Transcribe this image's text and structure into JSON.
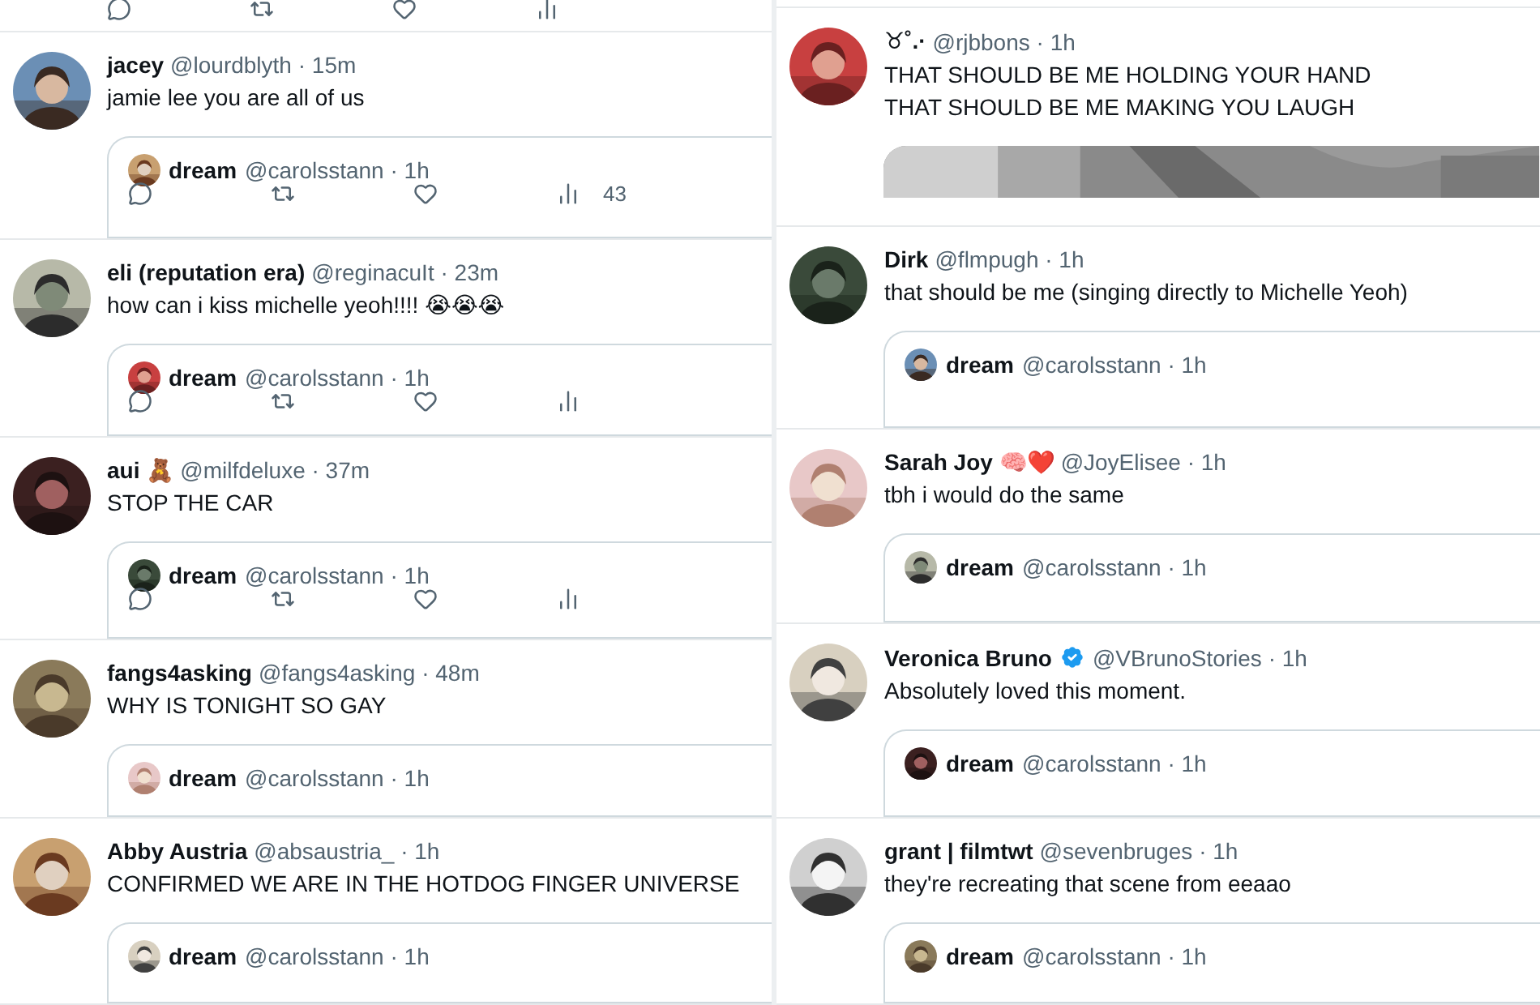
{
  "columns": [
    {
      "top_actions": true,
      "tweets": [
        {
          "name": "jacey",
          "meta": "@lourdblyth · 15m",
          "text": "jamie lee you are all of us",
          "verified": false,
          "quote": {
            "name": "dream",
            "meta": "@carolsstann · 1h"
          },
          "actions": true,
          "views": "43"
        },
        {
          "name": "eli (reputation era)",
          "meta": "@reginacuIt · 23m",
          "text": "how can i kiss michelle yeoh!!!! 😭😭😭",
          "verified": false,
          "quote": {
            "name": "dream",
            "meta": "@carolsstann · 1h"
          },
          "actions": true
        },
        {
          "name": "aui 🧸",
          "meta": "@milfdeluxe · 37m",
          "text": "STOP THE CAR",
          "verified": false,
          "quote": {
            "name": "dream",
            "meta": "@carolsstann · 1h"
          },
          "actions": true
        },
        {
          "name": "fangs4asking",
          "meta": "@fangs4asking · 48m",
          "text": "WHY IS TONIGHT SO GAY",
          "verified": false,
          "quote": {
            "name": "dream",
            "meta": "@carolsstann · 1h"
          }
        },
        {
          "name": "Abby Austria",
          "meta": "@absaustria_ · 1h",
          "text": "CONFIRMED WE ARE IN THE HOTDOG FINGER UNIVERSE",
          "verified": false,
          "quote": {
            "name": "dream",
            "meta": "@carolsstann · 1h"
          }
        }
      ]
    },
    {
      "top_actions": false,
      "tweets": [
        {
          "name": "♉˚.·",
          "meta": "@rjbbons · 1h",
          "text": "THAT SHOULD BE ME HOLDING YOUR HAND\nTHAT SHOULD BE ME MAKING YOU LAUGH",
          "verified": false
        },
        {
          "name": "Dirk",
          "meta": "@flmpugh · 1h",
          "text": "that should be me (singing directly to Michelle Yeoh)",
          "verified": false,
          "quote": {
            "name": "dream",
            "meta": "@carolsstann · 1h"
          }
        },
        {
          "name": "Sarah Joy 🧠❤️",
          "meta": "@JoyElisee · 1h",
          "text": "tbh i would do the same",
          "verified": false,
          "quote": {
            "name": "dream",
            "meta": "@carolsstann · 1h"
          }
        },
        {
          "name": "Veronica Bruno",
          "meta": "@VBrunoStories · 1h",
          "text": "Absolutely loved this moment.",
          "verified": true,
          "quote": {
            "name": "dream",
            "meta": "@carolsstann · 1h"
          }
        },
        {
          "name": "grant | filmtwt",
          "meta": "@sevenbruges · 1h",
          "text": "they're recreating that scene from eeaao",
          "verified": false,
          "quote": {
            "name": "dream",
            "meta": "@carolsstann · 1h"
          }
        }
      ]
    }
  ]
}
